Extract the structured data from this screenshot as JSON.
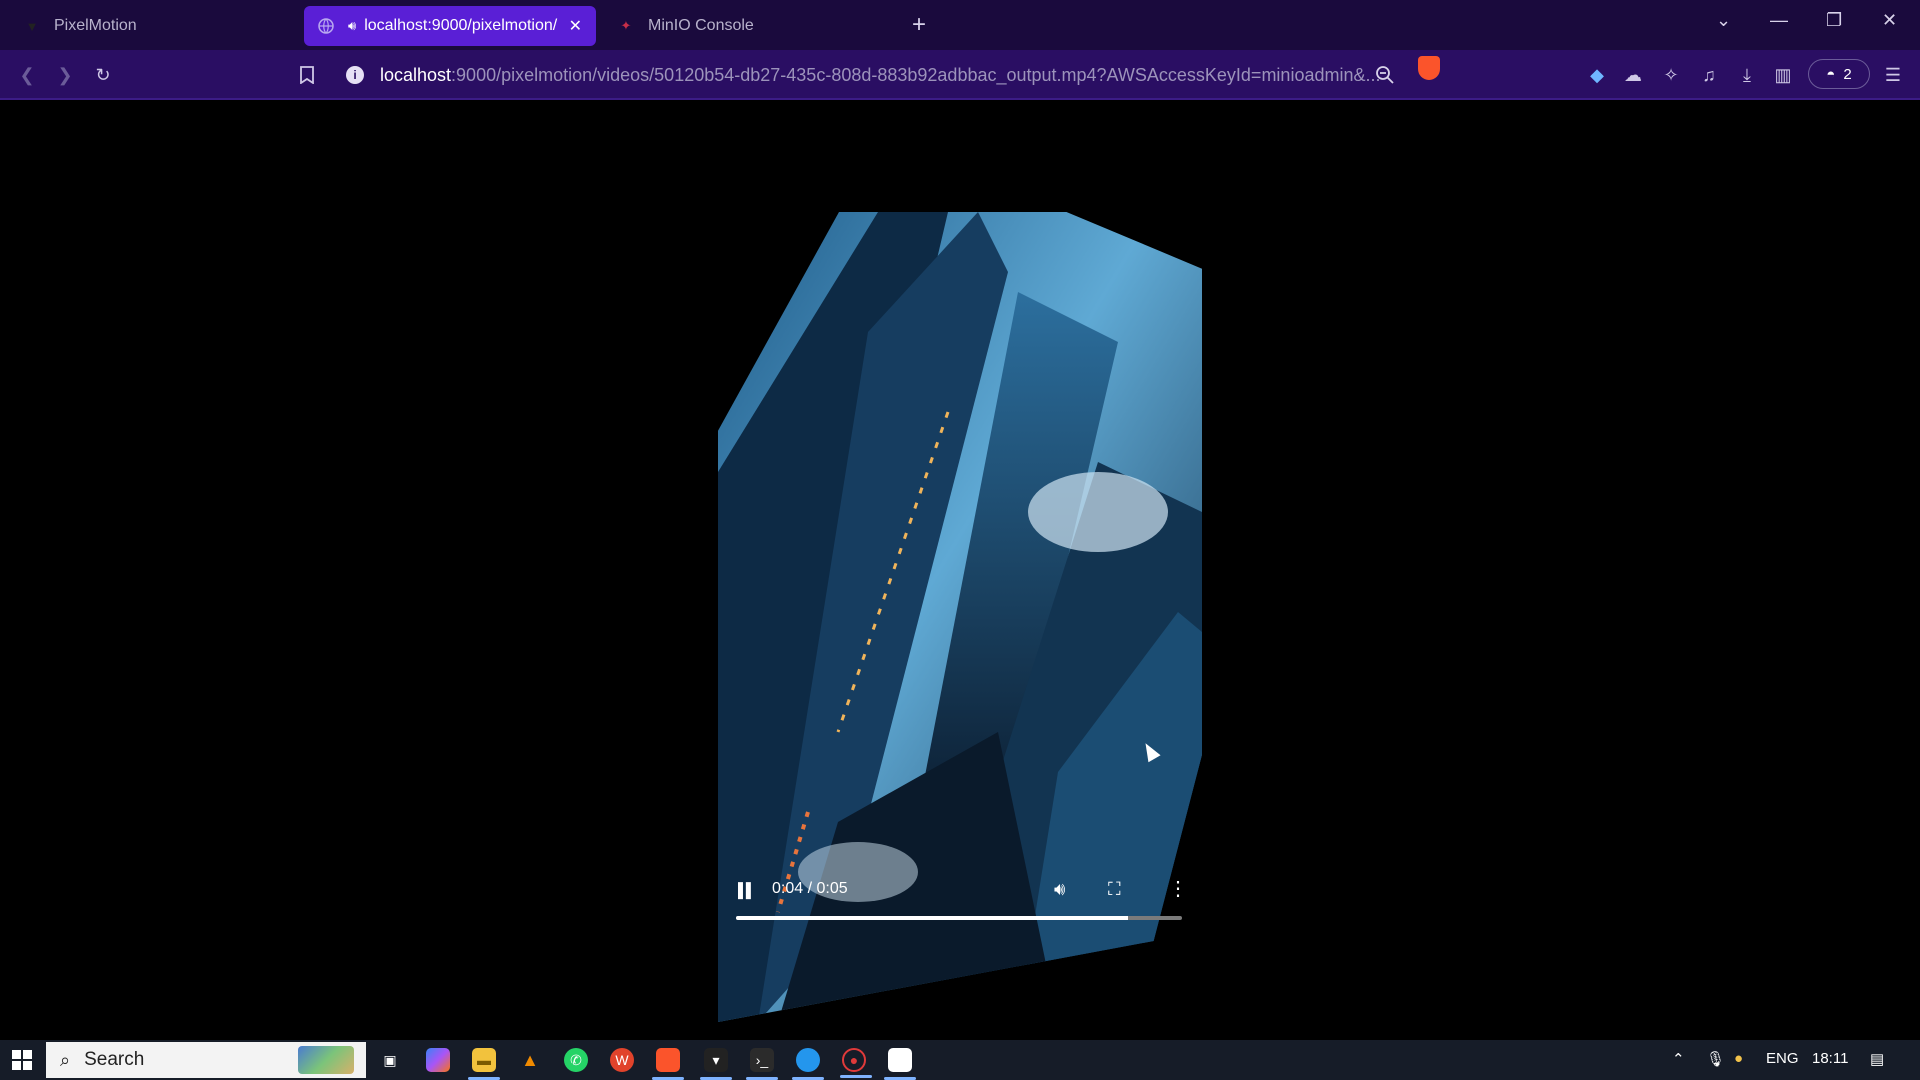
{
  "tabs": [
    {
      "label": "PixelMotion",
      "active": false
    },
    {
      "label": "localhost:9000/pixelmotion/",
      "active": true
    },
    {
      "label": "MinIO Console",
      "active": false
    }
  ],
  "toolbar": {
    "url_host": "localhost",
    "url_rest": ":9000/pixelmotion/videos/50120b54-db27-435c-808d-883b92adbbac_output.mp4?AWSAccessKeyId=minioadmin&...",
    "vpn_count": "2"
  },
  "video": {
    "time": "0:04 / 0:05",
    "progress_percent": 88
  },
  "taskbar": {
    "search_label": "Search",
    "language": "ENG",
    "clock": "18:11"
  },
  "colors": {
    "tab_active": "#5a1fd6",
    "toolbar": "#2a0e63",
    "tabstrip": "#1a0a3d",
    "brave": "#fb542b",
    "taskbar": "#161c28"
  }
}
